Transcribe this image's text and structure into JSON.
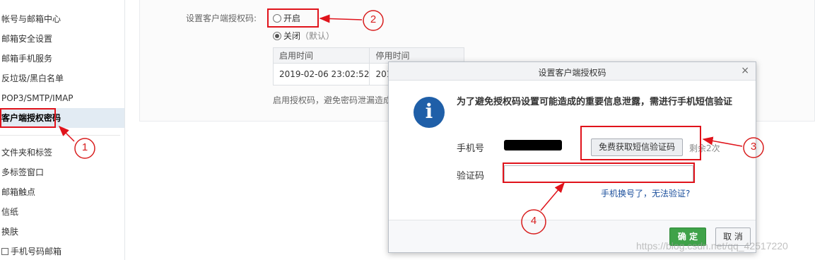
{
  "sidebar": {
    "items": [
      {
        "label": "帐号与邮箱中心"
      },
      {
        "label": "邮箱安全设置"
      },
      {
        "label": "邮箱手机服务"
      },
      {
        "label": "反垃圾/黑白名单"
      },
      {
        "label": "POP3/SMTP/IMAP"
      },
      {
        "label": "客户端授权密码"
      },
      {
        "label": "文件夹和标签"
      },
      {
        "label": "多标签窗口"
      },
      {
        "label": "邮箱触点"
      },
      {
        "label": "信纸"
      },
      {
        "label": "换肤"
      },
      {
        "label": "手机号码邮箱"
      }
    ]
  },
  "settings": {
    "label": "设置客户端授权码:",
    "option_on": "开启",
    "option_off": "关闭",
    "option_off_note": "（默认）",
    "table": {
      "headers": [
        "启用时间",
        "停用时间"
      ],
      "row": [
        "2019-02-06 23:02:52",
        "201"
      ]
    },
    "note": "启用授权码，避免密码泄漏造成"
  },
  "modal": {
    "title": "设置客户端授权码",
    "close": "×",
    "info_glyph": "i",
    "message": "为了避免授权码设置可能造成的重要信息泄露，需进行手机短信验证",
    "phone_label": "手机号",
    "sms_button": "免费获取短信验证码",
    "remaining": "剩余2次",
    "code_label": "验证码",
    "code_value": "",
    "phone_changed_link": "手机换号了，无法验证?",
    "ok_button": "确 定",
    "cancel_button": "取 消",
    "ok_color": "#3fa249"
  },
  "annotations": {
    "steps": [
      "1",
      "2",
      "3",
      "4"
    ],
    "color": "#e0131b"
  },
  "watermark": "https://blog.csdn.net/qq_42517220"
}
